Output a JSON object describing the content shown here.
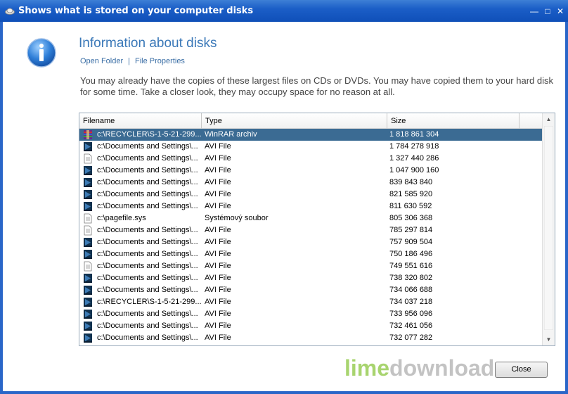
{
  "window": {
    "title": "Shows what is stored on your computer disks",
    "controls": [
      "minimize-icon",
      "maximize-icon",
      "close-icon"
    ]
  },
  "header": {
    "heading": "Information about disks",
    "links": [
      "Open Folder",
      "File Properties"
    ],
    "description": "You may already have the copies of these largest files on CDs or DVDs. You may have copied them to your hard disk for some time. Take a closer look, they may occupy space for no reason at all."
  },
  "table": {
    "columns": [
      "Filename",
      "Type",
      "Size"
    ],
    "rows": [
      {
        "icon": "rar-icon",
        "name": "c:\\RECYCLER\\S-1-5-21-299...",
        "type": "WinRAR archiv",
        "size": "1 818 861 304",
        "selected": true
      },
      {
        "icon": "video-file-icon",
        "name": "c:\\Documents and Settings\\...",
        "type": "AVI File",
        "size": "1 784 278 918"
      },
      {
        "icon": "document-file-icon",
        "name": "c:\\Documents and Settings\\...",
        "type": "AVI File",
        "size": "1 327 440 286"
      },
      {
        "icon": "video-file-icon",
        "name": "c:\\Documents and Settings\\...",
        "type": "AVI File",
        "size": "1 047 900 160"
      },
      {
        "icon": "video-file-icon",
        "name": "c:\\Documents and Settings\\...",
        "type": "AVI File",
        "size": "839 843 840"
      },
      {
        "icon": "video-file-icon",
        "name": "c:\\Documents and Settings\\...",
        "type": "AVI File",
        "size": "821 585 920"
      },
      {
        "icon": "video-file-icon",
        "name": "c:\\Documents and Settings\\...",
        "type": "AVI File",
        "size": "811 630 592"
      },
      {
        "icon": "document-file-icon",
        "name": "c:\\pagefile.sys",
        "type": "Systémový soubor",
        "size": "805 306 368"
      },
      {
        "icon": "document-file-icon",
        "name": "c:\\Documents and Settings\\...",
        "type": "AVI File",
        "size": "785 297 814"
      },
      {
        "icon": "video-file-icon",
        "name": "c:\\Documents and Settings\\...",
        "type": "AVI File",
        "size": "757 909 504"
      },
      {
        "icon": "video-file-icon",
        "name": "c:\\Documents and Settings\\...",
        "type": "AVI File",
        "size": "750 186 496"
      },
      {
        "icon": "document-file-icon",
        "name": "c:\\Documents and Settings\\...",
        "type": "AVI File",
        "size": "749 551 616"
      },
      {
        "icon": "video-file-icon",
        "name": "c:\\Documents and Settings\\...",
        "type": "AVI File",
        "size": "738 320 802"
      },
      {
        "icon": "video-file-icon",
        "name": "c:\\Documents and Settings\\...",
        "type": "AVI File",
        "size": "734 066 688"
      },
      {
        "icon": "video-file-icon",
        "name": "c:\\RECYCLER\\S-1-5-21-299...",
        "type": "AVI File",
        "size": "734 037 218"
      },
      {
        "icon": "video-file-icon",
        "name": "c:\\Documents and Settings\\...",
        "type": "AVI File",
        "size": "733 956 096"
      },
      {
        "icon": "video-file-icon",
        "name": "c:\\Documents and Settings\\...",
        "type": "AVI File",
        "size": "732 461 056"
      },
      {
        "icon": "video-file-icon",
        "name": "c:\\Documents and Settings\\...",
        "type": "AVI File",
        "size": "732 077 282"
      }
    ]
  },
  "footer": {
    "close_label": "Close",
    "watermark_a": "lime",
    "watermark_b": "download.com"
  },
  "colors": {
    "titlebar": "#1b5ec7",
    "selection": "#3b6b93",
    "heading": "#3a78b8",
    "link": "#3a6ea5"
  }
}
